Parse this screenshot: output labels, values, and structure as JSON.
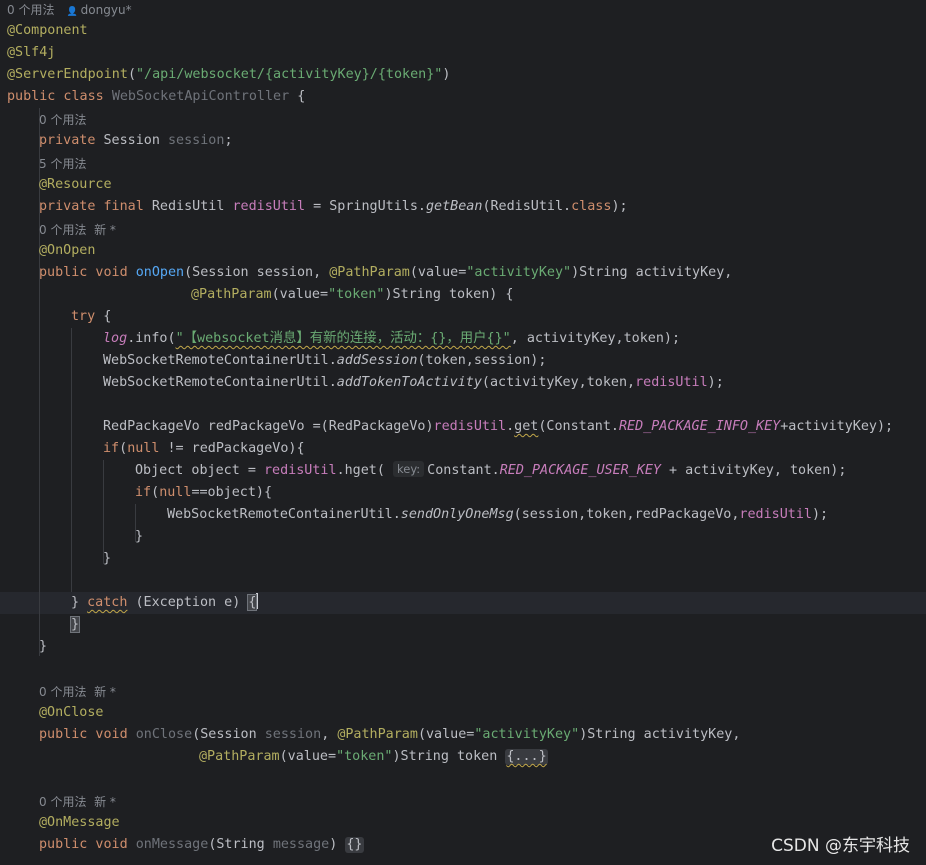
{
  "hints": {
    "class_usages": "0 个用法",
    "author": "dongyu",
    "author_marker": "*",
    "session_usages": "0 个用法",
    "redis_usages": "5 个用法",
    "onopen_usages": "0 个用法",
    "onclose_usages": "0 个用法",
    "onmessage_usages": "0 个用法",
    "new_label": "新 *",
    "param_key": "key:"
  },
  "code": {
    "l1": "@Component",
    "l2": "@Slf4j",
    "l3_ann": "@ServerEndpoint",
    "l3_open": "(",
    "l3_str": "\"/api/websocket/{activityKey}/{token}\"",
    "l3_close": ")",
    "l4_kw": "public class ",
    "l4_name": "WebSocketApiController",
    "l4_brace": " {",
    "l5_kw": "private ",
    "l5_type": "Session ",
    "l5_var": "session",
    "l5_end": ";",
    "l6_ann": "@Resource",
    "l7_kw": "private final ",
    "l7_type": "RedisUtil ",
    "l7_var": "redisUtil",
    "l7_eq": " = SpringUtils.",
    "l7_call": "getBean",
    "l7_args": "(RedisUtil.",
    "l7_cls": "class",
    "l7_end": ");",
    "l8_ann": "@OnOpen",
    "l9_kw": "public void ",
    "l9_fn": "onOpen",
    "l9_a": "(Session session, ",
    "l9_ann": "@PathParam",
    "l9_b": "(value=",
    "l9_str": "\"activityKey\"",
    "l9_c": ")String activityKey,",
    "l10_ann": "@PathParam",
    "l10_a": "(value=",
    "l10_str": "\"token\"",
    "l10_b": ")String token) {",
    "l11_kw": "try",
    "l11_b": " {",
    "l12_log": "log",
    "l12_a": ".info(",
    "l12_str": "\"【websocket消息】有新的连接，活动：{}，用户{}\"",
    "l12_b": ", activityKey,token);",
    "l13_a": "WebSocketRemoteContainerUtil.",
    "l13_call": "addSession",
    "l13_b": "(token,session);",
    "l14_a": "WebSocketRemoteContainerUtil.",
    "l14_call": "addTokenToActivity",
    "l14_b": "(activityKey,token,",
    "l14_fld": "redisUtil",
    "l14_c": ");",
    "l15_a": "RedPackageVo redPackageVo =(RedPackageVo)",
    "l15_fld": "redisUtil",
    "l15_b": ".",
    "l15_get": "get",
    "l15_c": "(Constant.",
    "l15_const": "RED_PACKAGE_INFO_KEY",
    "l15_d": "+activityKey);",
    "l16_kw": "if",
    "l16_a": "(",
    "l16_null": "null",
    "l16_b": " != redPackageVo){",
    "l17_a": "Object object = ",
    "l17_fld": "redisUtil",
    "l17_b": ".hget( ",
    "l17_c": "Constant.",
    "l17_const": "RED_PACKAGE_USER_KEY",
    "l17_d": " + activityKey, token);",
    "l18_kw": "if",
    "l18_a": "(",
    "l18_null": "null",
    "l18_b": "==object){",
    "l19_a": "WebSocketRemoteContainerUtil.",
    "l19_call": "sendOnlyOneMsg",
    "l19_b": "(session,token,redPackageVo,",
    "l19_fld": "redisUtil",
    "l19_c": ");",
    "l20": "}",
    "l21": "}",
    "l22_a": "} ",
    "l22_kw": "catch",
    "l22_b": " (Exception e) ",
    "l22_brace": "{",
    "l23": "}",
    "l24": "}",
    "l25_ann": "@OnClose",
    "l26_kw": "public void ",
    "l26_fn": "onClose",
    "l26_a": "(Session ",
    "l26_unused": "session",
    "l26_b": ", ",
    "l26_ann": "@PathParam",
    "l26_c": "(value=",
    "l26_str": "\"activityKey\"",
    "l26_d": ")String activityKey,",
    "l27_ann": "@PathParam",
    "l27_a": "(value=",
    "l27_str": "\"token\"",
    "l27_b": ")String token ",
    "l27_fold": "{...}",
    "l28_ann": "@OnMessage",
    "l29_kw": "public void ",
    "l29_fn": "onMessage",
    "l29_a": "(String ",
    "l29_unused": "message",
    "l29_b": ") ",
    "l29_fold": "{}"
  },
  "watermark": "CSDN @东宇科技"
}
